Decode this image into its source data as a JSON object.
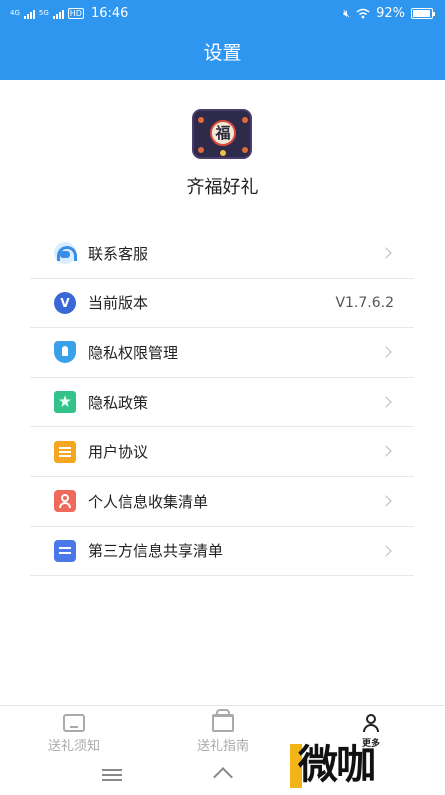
{
  "status_bar": {
    "network_1": "4G",
    "network_2": "5G",
    "hd": "HD",
    "time": "16:46",
    "battery": "92%",
    "battery_level": 0.92
  },
  "header": {
    "title": "设置"
  },
  "app": {
    "name": "齐福好礼",
    "logo_char": "福"
  },
  "menu": [
    {
      "label": "联系客服",
      "icon": "customer-service-icon",
      "color": "#3a8ee6"
    },
    {
      "label": "当前版本",
      "icon": "version-icon",
      "value": "V1.7.6.2",
      "color": "#3b66d6"
    },
    {
      "label": "隐私权限管理",
      "icon": "shield-key-icon",
      "color": "#3aa0e8"
    },
    {
      "label": "隐私政策",
      "icon": "star-bookmark-icon",
      "color": "#33c28a"
    },
    {
      "label": "用户协议",
      "icon": "document-icon",
      "color": "#f5a623"
    },
    {
      "label": "个人信息收集清单",
      "icon": "person-card-icon",
      "color": "#ef6a5b"
    },
    {
      "label": "第三方信息共享清单",
      "icon": "list-doc-icon",
      "color": "#4a78e8"
    }
  ],
  "tabs": [
    {
      "label": "送礼须知",
      "icon": "home-icon",
      "active": false
    },
    {
      "label": "送礼指南",
      "icon": "gift-box-icon",
      "active": false
    },
    {
      "label": "更多",
      "icon": "user-icon",
      "active": true
    }
  ],
  "watermark": {
    "text": "微咖"
  }
}
